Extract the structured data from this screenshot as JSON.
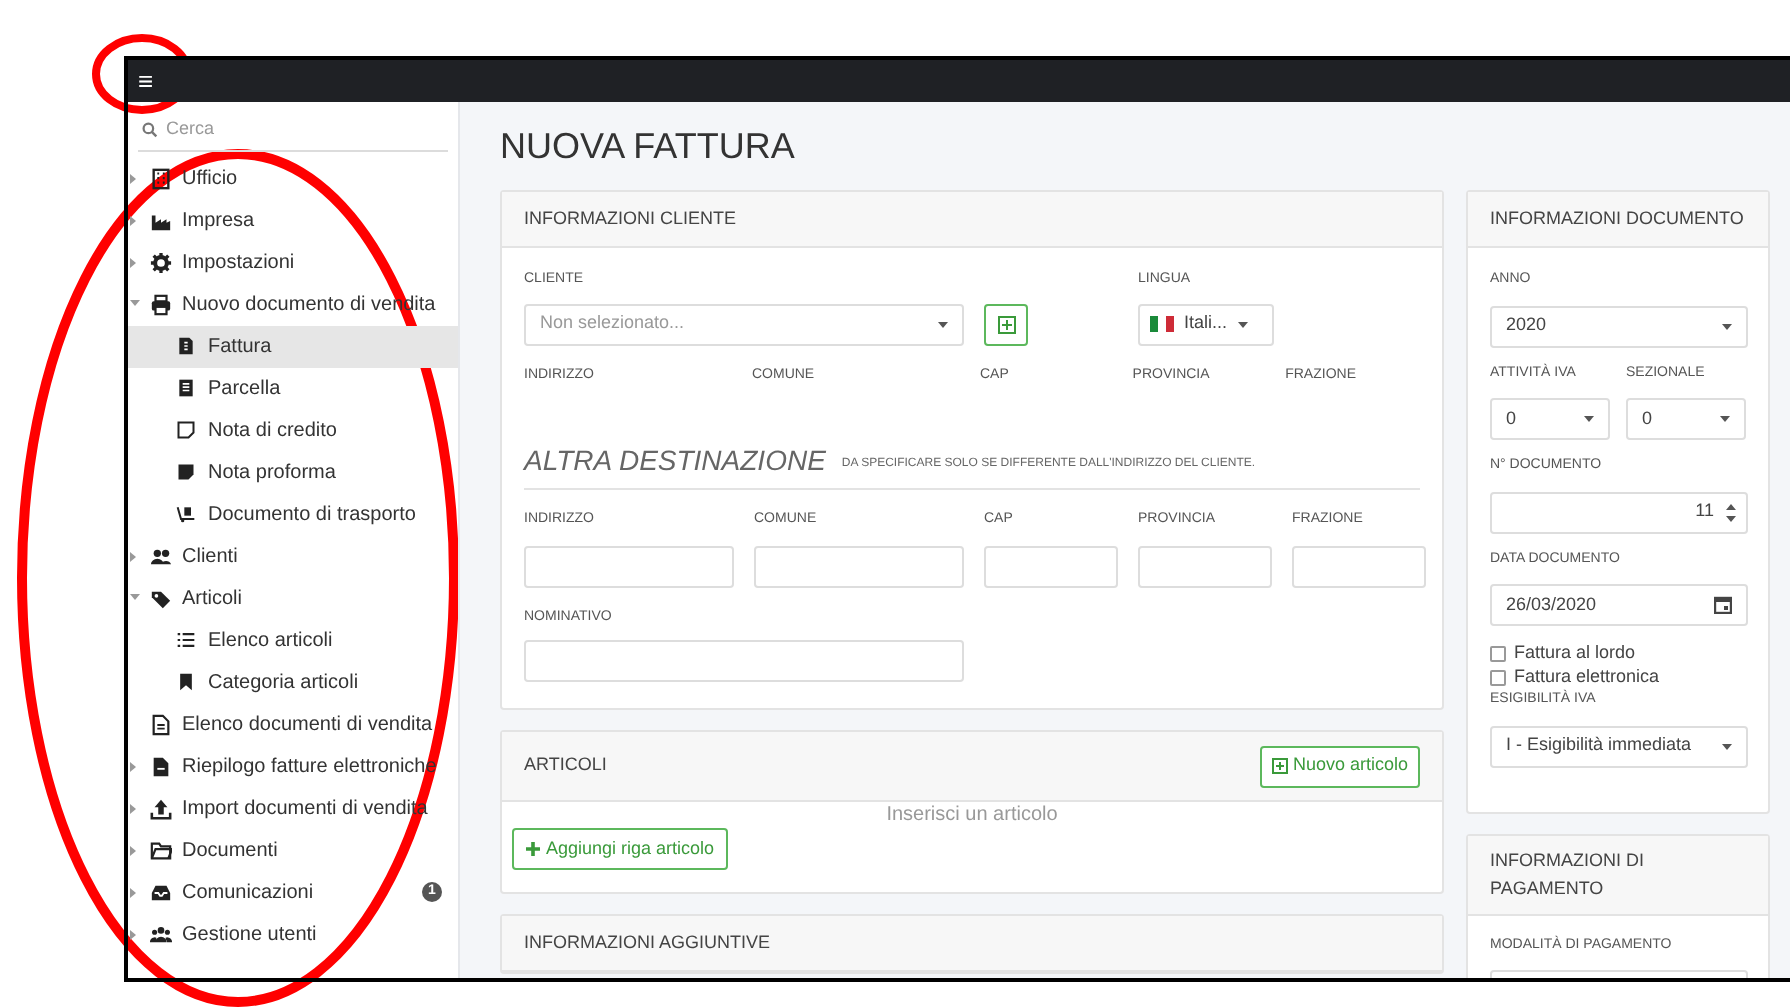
{
  "topbar": {
    "menu_icon": "≡"
  },
  "sidebar": {
    "search_placeholder": "Cerca",
    "items": [
      {
        "label": "Ufficio",
        "kind": "group",
        "expanded": false,
        "selected": false
      },
      {
        "label": "Impresa",
        "kind": "group",
        "expanded": false,
        "selected": false
      },
      {
        "label": "Impostazioni",
        "kind": "group",
        "expanded": false,
        "selected": false
      },
      {
        "label": "Nuovo documento di vendita",
        "kind": "group",
        "expanded": true,
        "selected": false,
        "children": [
          {
            "label": "Fattura",
            "selected": true
          },
          {
            "label": "Parcella",
            "selected": false
          },
          {
            "label": "Nota di credito",
            "selected": false
          },
          {
            "label": "Nota proforma",
            "selected": false
          },
          {
            "label": "Documento di trasporto",
            "selected": false
          }
        ]
      },
      {
        "label": "Clienti",
        "kind": "group",
        "expanded": false,
        "selected": false
      },
      {
        "label": "Articoli",
        "kind": "group",
        "expanded": true,
        "selected": false,
        "children": [
          {
            "label": "Elenco articoli",
            "selected": false
          },
          {
            "label": "Categoria articoli",
            "selected": false
          }
        ]
      },
      {
        "label": "Elenco documenti di vendita",
        "kind": "link",
        "selected": false
      },
      {
        "label": "Riepilogo fatture elettroniche",
        "kind": "group",
        "expanded": false,
        "selected": false
      },
      {
        "label": "Import documenti di vendita",
        "kind": "group",
        "expanded": false,
        "selected": false
      },
      {
        "label": "Documenti",
        "kind": "group",
        "expanded": false,
        "selected": false
      },
      {
        "label": "Comunicazioni",
        "kind": "group",
        "expanded": false,
        "selected": false,
        "badge": "1"
      },
      {
        "label": "Gestione utenti",
        "kind": "group",
        "expanded": false,
        "selected": false
      }
    ]
  },
  "page_title": "NUOVA FATTURA",
  "cliente": {
    "title": "INFORMAZIONI CLIENTE",
    "cliente_label": "CLIENTE",
    "cliente_placeholder": "Non selezionato...",
    "lingua_label": "LINGUA",
    "lingua_value": "Itali...",
    "address_labels": [
      "INDIRIZZO",
      "COMUNE",
      "CAP",
      "PROVINCIA",
      "FRAZIONE"
    ],
    "altra_title": "ALTRA DESTINAZIONE",
    "altra_note": "DA SPECIFICARE SOLO SE DIFFERENTE DALL'INDIRIZZO DEL CLIENTE.",
    "altra_labels": [
      "INDIRIZZO",
      "COMUNE",
      "CAP",
      "PROVINCIA",
      "FRAZIONE"
    ],
    "nominativo_label": "NOMINATIVO"
  },
  "articoli": {
    "title": "ARTICOLI",
    "new_button": "Nuovo articolo",
    "empty": "Inserisci un articolo",
    "add_button": "Aggiungi riga articolo"
  },
  "aggiuntive": {
    "title": "INFORMAZIONI AGGIUNTIVE"
  },
  "documento": {
    "title": "INFORMAZIONI DOCUMENTO",
    "anno_label": "ANNO",
    "anno": "2020",
    "attivita_label": "ATTIVITÀ IVA",
    "attivita": "0",
    "sezionale_label": "SEZIONALE",
    "sezionale": "0",
    "numero_label": "N° DOCUMENTO",
    "numero": "11",
    "data_label": "DATA DOCUMENTO",
    "data": "26/03/2020",
    "checkboxes": [
      {
        "label": "Fattura al lordo",
        "checked": false
      },
      {
        "label": "Fattura elettronica",
        "checked": false
      }
    ],
    "esigibilita_label": "ESIGIBILITÀ IVA",
    "esigibilita": "I - Esigibilità immediata"
  },
  "pagamento": {
    "title": "INFORMAZIONI DI PAGAMENTO",
    "modalita_label": "MODALITÀ DI PAGAMENTO"
  }
}
